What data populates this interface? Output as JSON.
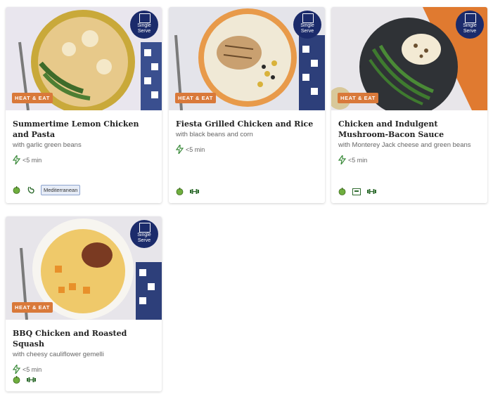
{
  "badge": {
    "line1": "Single",
    "line2": "Serve"
  },
  "tag_label": "HEAT & EAT",
  "cards": [
    {
      "title": "Summertime Lemon Chicken and Pasta",
      "subtitle": "with garlic green beans",
      "time": "<5 min",
      "icons": [
        "apple-icon",
        "stomach-icon"
      ],
      "cuisine": "Mediterranean",
      "colors": {
        "bg": "#e9e6ee",
        "plate": "#c9a93a",
        "food": "#e7c98a",
        "accent": "#3e6b2a"
      }
    },
    {
      "title": "Fiesta Grilled Chicken and Rice",
      "subtitle": "with black beans and corn",
      "time": "<5 min",
      "icons": [
        "apple-icon",
        "dumbbell-icon"
      ],
      "colors": {
        "bg": "#e4e4ea",
        "plate": "#e89a4a",
        "food": "#f0e9d6",
        "accent": "#d9b23a"
      }
    },
    {
      "title": "Chicken and Indulgent Mushroom-Bacon Sauce",
      "subtitle": "with Monterey Jack cheese and green beans",
      "time": "<5 min",
      "icons": [
        "apple-icon",
        "scale-icon",
        "dumbbell-icon"
      ],
      "colors": {
        "bg": "#e8e6ea",
        "plate": "#2f3236",
        "food": "#f3ead4",
        "accent": "#3f7a2f"
      }
    },
    {
      "title": "BBQ Chicken and Roasted Squash",
      "subtitle": "with cheesy cauliflower gemelli",
      "time": "<5 min",
      "icons": [
        "apple-icon",
        "dumbbell-icon"
      ],
      "colors": {
        "bg": "#e7e5ea",
        "plate": "#f7f5f0",
        "food": "#efc96a",
        "accent": "#7a3a22"
      }
    }
  ]
}
